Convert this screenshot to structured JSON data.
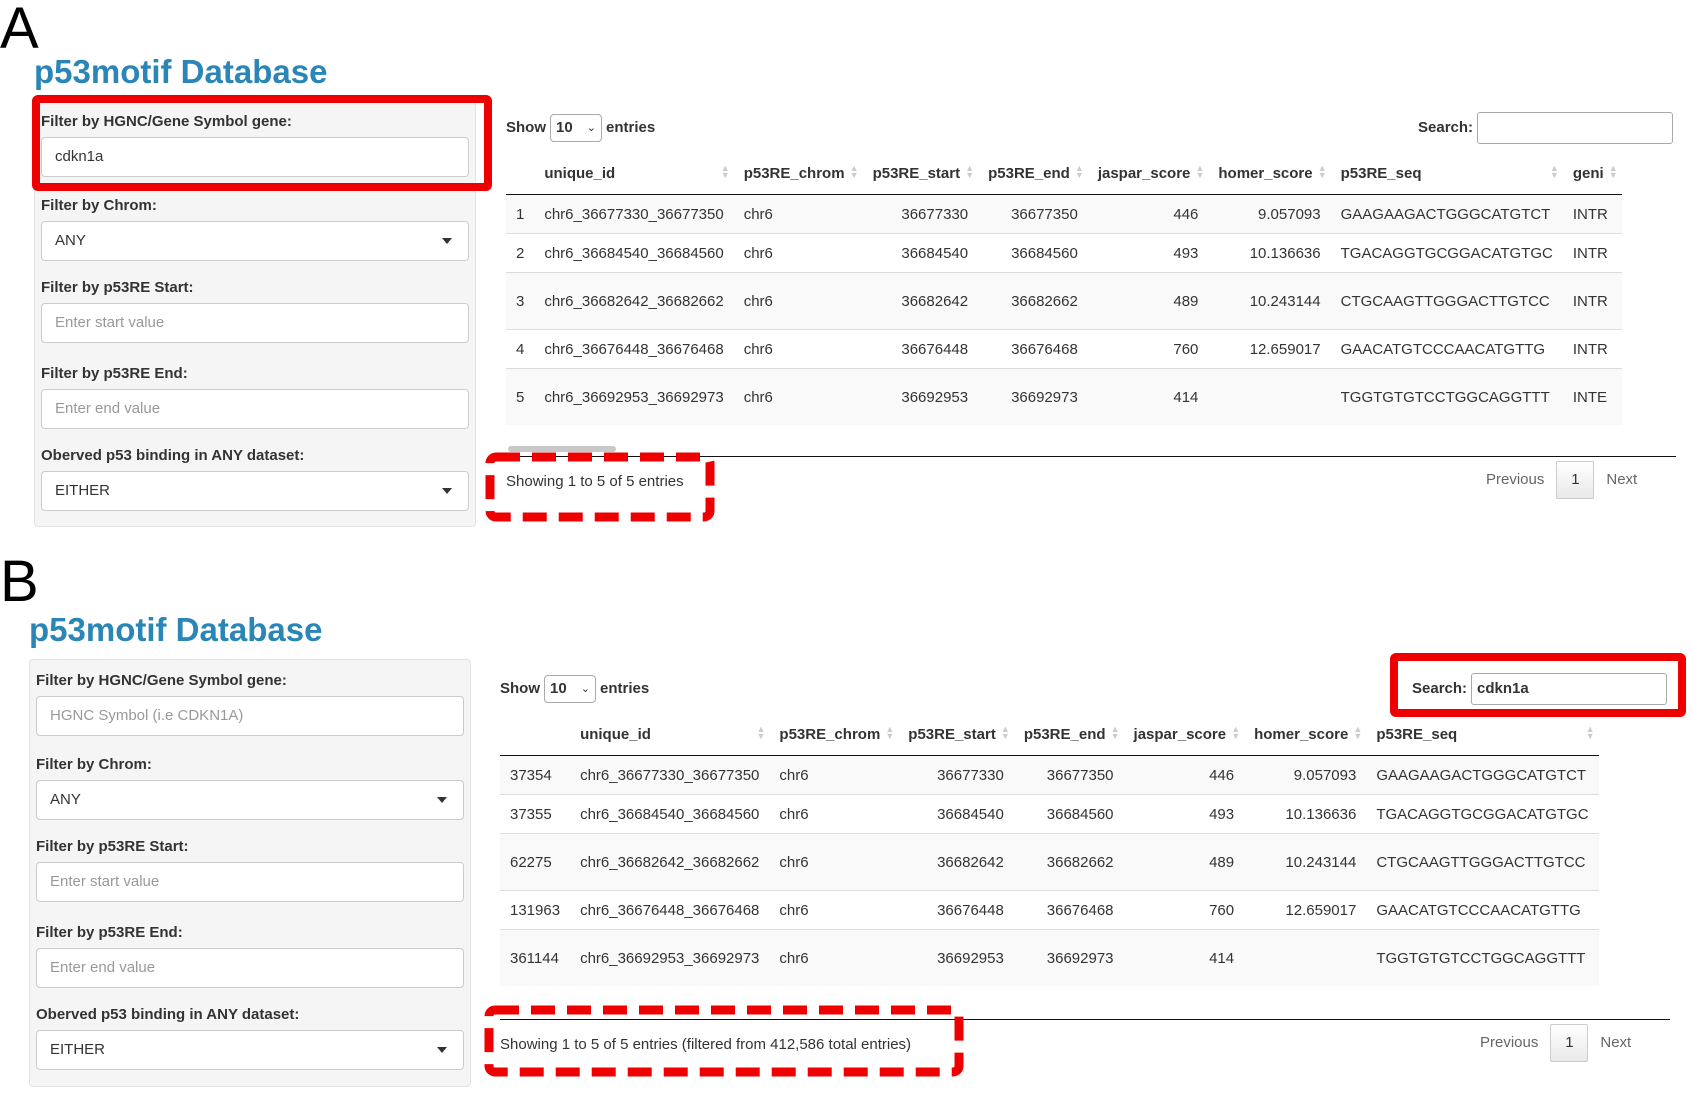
{
  "panels": {
    "a": {
      "letter": "A",
      "app_title": "p53motif Database",
      "filters": {
        "gene_label": "Filter by HGNC/Gene Symbol gene:",
        "gene_value": "cdkn1a",
        "chrom_label": "Filter by Chrom:",
        "chrom_value": "ANY",
        "start_label": "Filter by p53RE Start:",
        "start_placeholder": "Enter start value",
        "end_label": "Filter by p53RE End:",
        "end_placeholder": "Enter end value",
        "binding_label": "Oberved p53 binding in ANY dataset:",
        "binding_value": "EITHER"
      },
      "length": {
        "show": "Show",
        "value": "10",
        "entries": "entries"
      },
      "search": {
        "label": "Search:",
        "value": ""
      },
      "columns": [
        "",
        "unique_id",
        "p53RE_chrom",
        "p53RE_start",
        "p53RE_end",
        "jaspar_score",
        "homer_score",
        "p53RE_seq",
        "geni"
      ],
      "rows": [
        [
          "1",
          "chr6_36677330_36677350",
          "chr6",
          "36677330",
          "36677350",
          "446",
          "9.057093",
          "GAAGAAGACTGGGCATGTCT",
          "INTR"
        ],
        [
          "2",
          "chr6_36684540_36684560",
          "chr6",
          "36684540",
          "36684560",
          "493",
          "10.136636",
          "TGACAGGTGCGGACATGTGC",
          "INTR"
        ],
        [
          "3",
          "chr6_36682642_36682662",
          "chr6",
          "36682642",
          "36682662",
          "489",
          "10.243144",
          "CTGCAAGTTGGGACTTGTCC",
          "INTR"
        ],
        [
          "4",
          "chr6_36676448_36676468",
          "chr6",
          "36676448",
          "36676468",
          "760",
          "12.659017",
          "GAACATGTCCCAACATGTTG",
          "INTR"
        ],
        [
          "5",
          "chr6_36692953_36692973",
          "chr6",
          "36692953",
          "36692973",
          "414",
          "",
          "TGGTGTGTCCTGGCAGGTTT",
          "INTE"
        ]
      ],
      "info": "Showing 1 to 5 of 5 entries",
      "pager": {
        "previous": "Previous",
        "page": "1",
        "next": "Next"
      }
    },
    "b": {
      "letter": "B",
      "app_title": "p53motif Database",
      "filters": {
        "gene_label": "Filter by HGNC/Gene Symbol gene:",
        "gene_placeholder": "HGNC Symbol (i.e CDKN1A)",
        "chrom_label": "Filter by Chrom:",
        "chrom_value": "ANY",
        "start_label": "Filter by p53RE Start:",
        "start_placeholder": "Enter start value",
        "end_label": "Filter by p53RE End:",
        "end_placeholder": "Enter end value",
        "binding_label": "Oberved p53 binding in ANY dataset:",
        "binding_value": "EITHER"
      },
      "length": {
        "show": "Show",
        "value": "10",
        "entries": "entries"
      },
      "search": {
        "label": "Search:",
        "value": "cdkn1a"
      },
      "columns": [
        "",
        "unique_id",
        "p53RE_chrom",
        "p53RE_start",
        "p53RE_end",
        "jaspar_score",
        "homer_score",
        "p53RE_seq"
      ],
      "rows": [
        [
          "37354",
          "chr6_36677330_36677350",
          "chr6",
          "36677330",
          "36677350",
          "446",
          "9.057093",
          "GAAGAAGACTGGGCATGTCT"
        ],
        [
          "37355",
          "chr6_36684540_36684560",
          "chr6",
          "36684540",
          "36684560",
          "493",
          "10.136636",
          "TGACAGGTGCGGACATGTGC"
        ],
        [
          "62275",
          "chr6_36682642_36682662",
          "chr6",
          "36682642",
          "36682662",
          "489",
          "10.243144",
          "CTGCAAGTTGGGACTTGTCC"
        ],
        [
          "131963",
          "chr6_36676448_36676468",
          "chr6",
          "36676448",
          "36676468",
          "760",
          "12.659017",
          "GAACATGTCCCAACATGTTG"
        ],
        [
          "361144",
          "chr6_36692953_36692973",
          "chr6",
          "36692953",
          "36692973",
          "414",
          "",
          "TGGTGTGTCCTGGCAGGTTT"
        ]
      ],
      "info": "Showing 1 to 5 of 5 entries (filtered from 412,586 total entries)",
      "pager": {
        "previous": "Previous",
        "page": "1",
        "next": "Next"
      }
    }
  },
  "colors": {
    "title": "#2a86b6",
    "highlight": "#ee0000",
    "sidebar_bg": "#f5f5f5"
  }
}
